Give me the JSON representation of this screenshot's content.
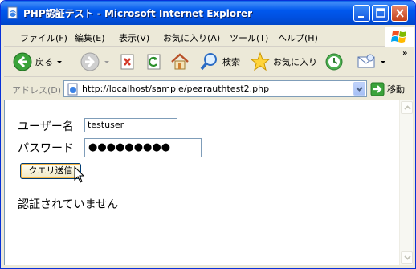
{
  "window": {
    "title": "PHP認証テスト - Microsoft Internet Explorer"
  },
  "menu": {
    "items": [
      "ファイル(F)",
      "編集(E)",
      "表示(V)",
      "お気に入り(A)",
      "ツール(T)",
      "ヘルプ(H)"
    ]
  },
  "toolbar": {
    "back_label": "戻る",
    "search_label": "検索",
    "favorites_label": "お気に入り",
    "icons": [
      "back-icon",
      "forward-icon",
      "stop-icon",
      "refresh-icon",
      "home-icon",
      "search-icon",
      "favorites-icon",
      "history-icon",
      "mail-icon"
    ]
  },
  "addressbar": {
    "label": "アドレス(D)",
    "url": "http://localhost/sample/pearauthtest2.php",
    "go_label": "移動"
  },
  "form": {
    "username_label": "ユーザー名",
    "username_value": "testuser",
    "password_label": "パスワード",
    "password_mask": "●●●●●●●●●",
    "submit_label": "クエリ送信"
  },
  "status_message": "認証されていません",
  "colors": {
    "titlebar": "#0058ee",
    "chrome": "#ece9d8",
    "input_border": "#7f9db9"
  }
}
